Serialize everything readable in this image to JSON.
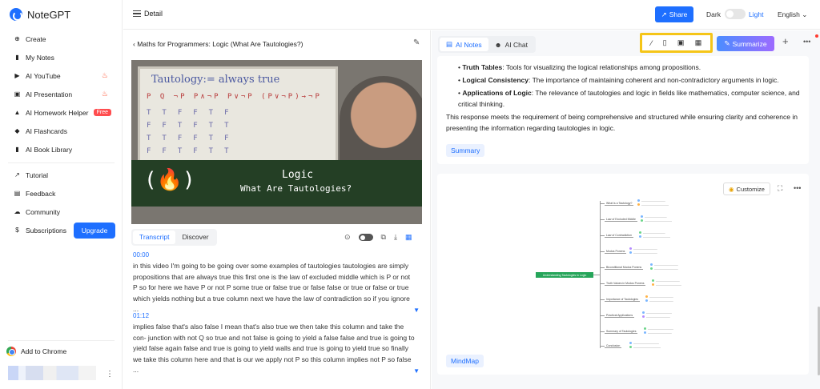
{
  "app": {
    "name": "NoteGPT"
  },
  "sidebar": {
    "items": [
      {
        "label": "Create",
        "icon": "plus-circle-icon"
      },
      {
        "label": "My Notes",
        "icon": "book-icon"
      },
      {
        "label": "AI YouTube",
        "icon": "youtube-icon",
        "hot": true
      },
      {
        "label": "AI Presentation",
        "icon": "presentation-icon",
        "hot": true
      },
      {
        "label": "AI Homework Helper",
        "icon": "graduation-cap-icon",
        "badge": "Free"
      },
      {
        "label": "AI Flashcards",
        "icon": "cards-icon"
      },
      {
        "label": "AI Book Library",
        "icon": "library-icon"
      }
    ],
    "secondary": [
      {
        "label": "Tutorial",
        "icon": "external-link-icon"
      },
      {
        "label": "Feedback",
        "icon": "feedback-icon"
      },
      {
        "label": "Community",
        "icon": "community-icon"
      },
      {
        "label": "Subscriptions",
        "icon": "dollar-icon"
      }
    ],
    "upgrade_label": "Upgrade",
    "add_to_chrome": "Add to Chrome"
  },
  "topbar": {
    "page": "Detail",
    "share": "Share",
    "dark": "Dark",
    "light": "Light",
    "language": "English"
  },
  "video_panel": {
    "title": "Maths for Programmers: Logic (What Are Tautologies?)",
    "video": {
      "board_title": "Tautology:= always true",
      "board_header": "P Q ¬P P∧¬P P∨¬P (P∨¬P)→¬P",
      "board_rows": [
        "TTFFTF",
        "FFTFTT",
        "TTFFTF",
        "FFTFTT"
      ],
      "banner_icon": "(🔥)",
      "banner_title": "Logic",
      "banner_subtitle": "What Are Tautologies?"
    },
    "tabs": [
      "Transcript",
      "Discover"
    ],
    "transcript": [
      {
        "time": "00:00",
        "text": "in this video I'm going to be going over some examples of tautologies tautologies are simply propositions that are always true this first one is the law of excluded middle which is P or not P so for here we have P or not P some true or false true or false false or true or false or true which yields nothing but a true column next we have the law of contradiction so if you ignore ..."
      },
      {
        "time": "01:12",
        "text": "implies false that's also false I mean that's also true we then take this column and take the con- junction with not Q so true and not false is going to yield a false false and true is going to yield false again false and true is going to yield walls and true is going to yield true so finally we take this column here and that is our we apply not P so this column implies not P so false ..."
      }
    ]
  },
  "notes_panel": {
    "tabs": [
      "AI Notes",
      "AI Chat"
    ],
    "summarize": "Summarize",
    "bullets": [
      {
        "term": "Truth Tables",
        "text": ": Tools for visualizing the logical relationships among propositions."
      },
      {
        "term": "Logical Consistency",
        "text": ": The importance of maintaining coherent and non-contradictory arguments in logic."
      },
      {
        "term": "Applications of Logic",
        "text": ": The relevance of tautologies and logic in fields like mathematics, computer science, and critical thinking."
      }
    ],
    "paragraph": "This response meets the requirement of being comprehensive and structured while ensuring clarity and coherence in presenting the information regarding tautologies in logic.",
    "summary_chip": "Summary",
    "customize": "Customize",
    "mindmap_chip": "MindMap",
    "mindmap": {
      "root": "Understanding Tautologies in Logic",
      "branches": [
        "What is a Tautology?",
        "Law of Excluded Middle",
        "Law of Contradiction",
        "Modus Ponens",
        "Biconditional Modus Ponens",
        "Truth Values in Modus Ponens",
        "Importance of Tautologies",
        "Practical Applications",
        "Summary of Tautologies",
        "Conclusion"
      ]
    }
  }
}
